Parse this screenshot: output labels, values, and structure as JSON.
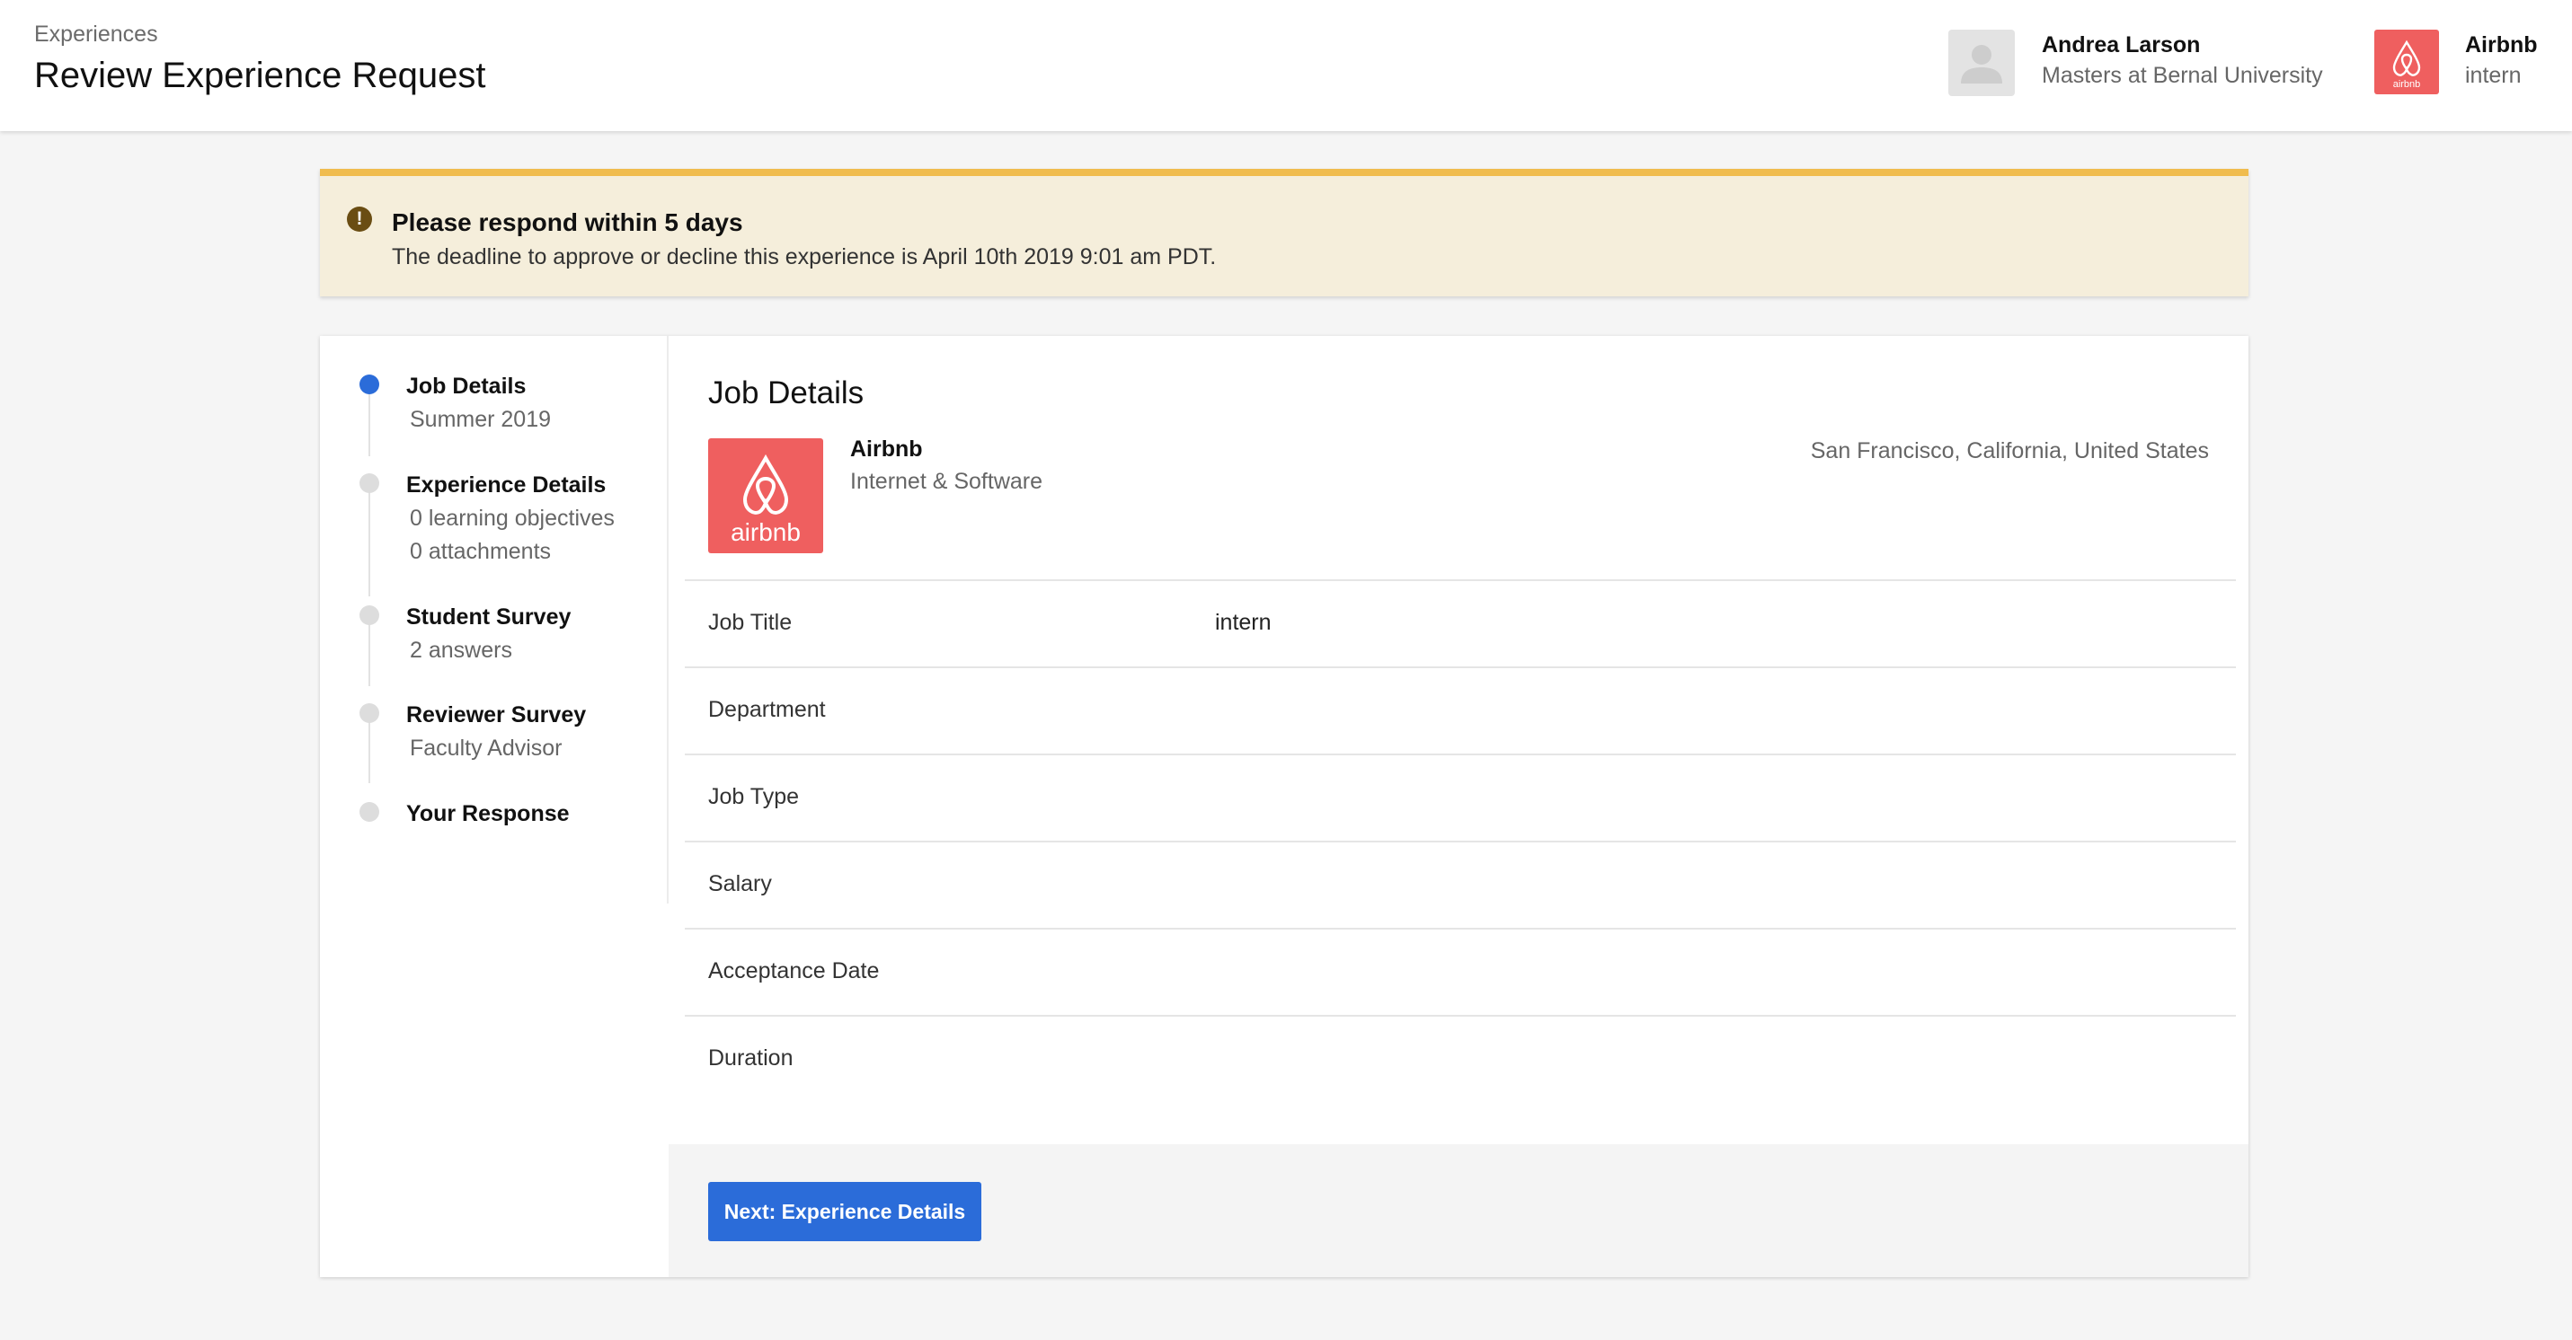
{
  "header": {
    "breadcrumb": "Experiences",
    "title": "Review Experience Request",
    "user": {
      "name": "Andrea Larson",
      "subtitle": "Masters at Bernal University"
    },
    "organization": {
      "name": "Airbnb",
      "subtitle": "intern",
      "logo_icon": "airbnb-logo-icon"
    }
  },
  "alert": {
    "icon": "exclamation-circle-icon",
    "icon_glyph": "!",
    "title": "Please respond within 5 days",
    "message": "The deadline to approve or decline this experience is April 10th 2019 9:01 am PDT."
  },
  "steps": [
    {
      "title": "Job Details",
      "subs": [
        "Summer 2019"
      ],
      "active": true
    },
    {
      "title": "Experience Details",
      "subs": [
        "0 learning objectives",
        "0 attachments"
      ],
      "active": false
    },
    {
      "title": "Student Survey",
      "subs": [
        "2 answers"
      ],
      "active": false
    },
    {
      "title": "Reviewer Survey",
      "subs": [
        "Faculty Advisor"
      ],
      "active": false
    },
    {
      "title": "Your Response",
      "subs": [],
      "active": false
    }
  ],
  "main": {
    "title": "Job Details",
    "company": {
      "name": "Airbnb",
      "industry": "Internet & Software",
      "location": "San Francisco, California, United States",
      "logo_text": "airbnb"
    },
    "fields": [
      {
        "label": "Job Title",
        "value": "intern"
      },
      {
        "label": "Department",
        "value": ""
      },
      {
        "label": "Job Type",
        "value": ""
      },
      {
        "label": "Salary",
        "value": ""
      },
      {
        "label": "Acceptance Date",
        "value": ""
      },
      {
        "label": "Duration",
        "value": ""
      }
    ],
    "next_button": "Next: Experience Details"
  },
  "colors": {
    "accent": "#2b6cd9",
    "airbnb_brand": "#ef5f5f",
    "alert_bg": "#f5eedb",
    "alert_border": "#f0bc4e"
  }
}
